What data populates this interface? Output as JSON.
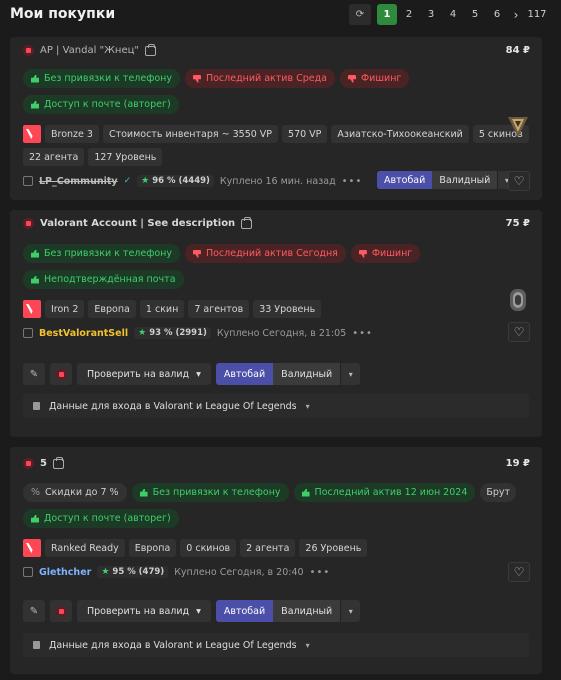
{
  "header": {
    "title": "Мои покупки",
    "pages": [
      "1",
      "2",
      "3",
      "4",
      "5",
      "6"
    ],
    "last_page": "117",
    "next_symbol": "›",
    "refresh_symbol": "⟳"
  },
  "cards": [
    {
      "title": "AP | Vandal \"Жнец\"",
      "price": "84 ₽",
      "tags_row1": [
        {
          "text": "Без привязки к телефону",
          "kind": "green"
        },
        {
          "text": "Последний актив Среда",
          "kind": "red"
        },
        {
          "text": "Фишинг",
          "kind": "red"
        }
      ],
      "tags_row2": [
        {
          "text": "Доступ к почте (авторег)",
          "kind": "green"
        }
      ],
      "chips_row1": [
        "Bronze 3",
        "Стоимость инвентаря ~ 3550 VP",
        "570 VP",
        "Азиатско-Тихоокеанский",
        "5 скинов"
      ],
      "chips_row2": [
        "22 агента",
        "127 Уровень"
      ],
      "seller": "LP_Community",
      "seller_color": "#bdbdbd",
      "rating": "96 % (4449)",
      "bought": "Куплено 16 мин. назад",
      "autobuy": "Автобай",
      "valid": "Валидный"
    },
    {
      "title": "Valorant Account | See description",
      "price": "75 ₽",
      "tags_row1": [
        {
          "text": "Без привязки к телефону",
          "kind": "green"
        },
        {
          "text": "Последний актив Сегодня",
          "kind": "red"
        },
        {
          "text": "Фишинг",
          "kind": "red"
        }
      ],
      "tags_row2": [
        {
          "text": "Неподтверждённая почта",
          "kind": "green"
        }
      ],
      "chips_row1": [
        "Iron 2",
        "Европа",
        "1 скин",
        "7 агентов",
        "33 Уровень"
      ],
      "seller": "BestValorantSell",
      "seller_color": "#f2c12e",
      "rating": "93 % (2991)",
      "bought": "Куплено Сегодня, в 21:05",
      "check_label": "Проверить на валид",
      "autobuy": "Автобай",
      "valid": "Валидный",
      "login_label": "Данные для входа в Valorant и League Of Legends"
    },
    {
      "title": "5",
      "price": "19 ₽",
      "tags_row1": [
        {
          "text": "Скидки до 7 %",
          "kind": "gray",
          "icon": "%"
        },
        {
          "text": "Без привязки к телефону",
          "kind": "green"
        },
        {
          "text": "Последний актив 12 июн 2024",
          "kind": "green"
        },
        {
          "text": "Брут",
          "kind": "gray"
        }
      ],
      "tags_row2": [
        {
          "text": "Доступ к почте (авторег)",
          "kind": "green"
        }
      ],
      "chips_row1": [
        "Ranked Ready",
        "Европа",
        "0 скинов",
        "2 агента",
        "26 Уровень"
      ],
      "seller": "Glethcher",
      "seller_color": "#7fb2ff",
      "rating": "95 % (479)",
      "bought": "Куплено Сегодня, в 20:40",
      "check_label": "Проверить на валид",
      "autobuy": "Автобай",
      "valid": "Валидный",
      "login_label": "Данные для входа в Valorant и League Of Legends"
    }
  ]
}
